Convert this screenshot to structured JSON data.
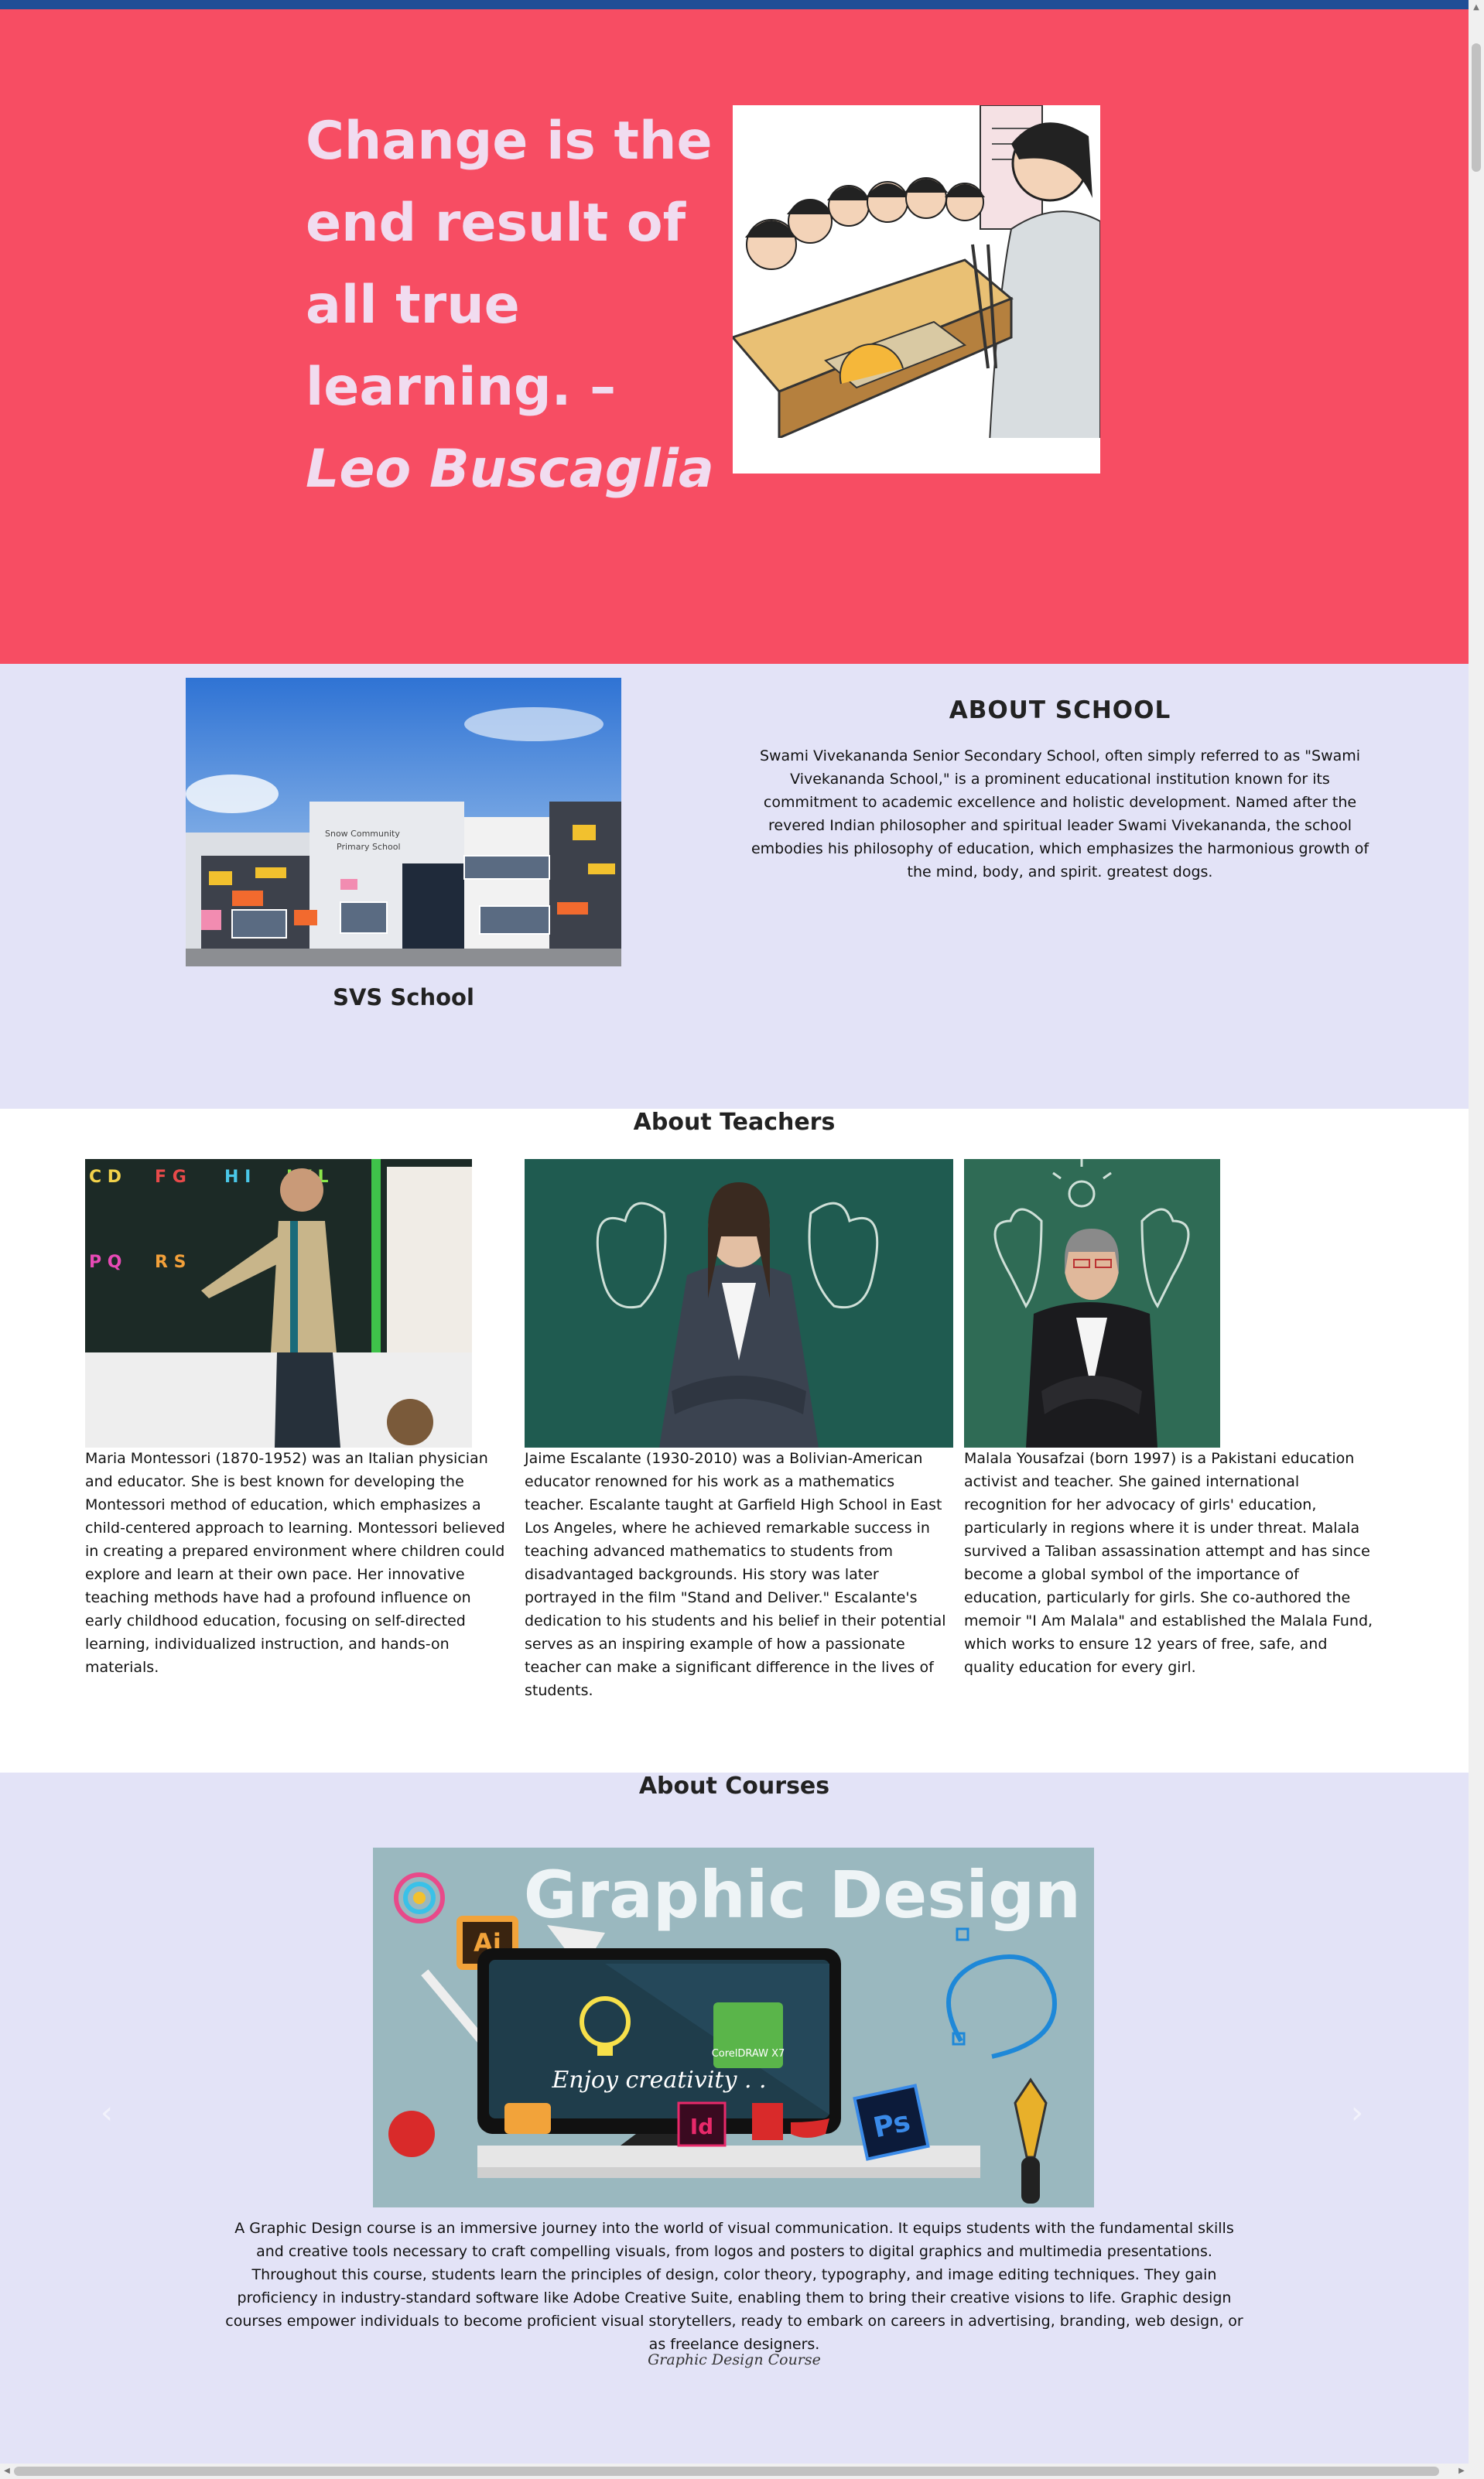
{
  "hero": {
    "quote": "Change is the end result of all true learning. –",
    "author": "Leo Buscaglia"
  },
  "about_school": {
    "photo_caption": "SVS School",
    "sign_text": "Snow Community Primary School",
    "title": "ABOUT SCHOOL",
    "text": "Swami Vivekananda Senior Secondary School, often simply referred to as \"Swami Vivekananda School,\" is a prominent educational institution known for its commitment to academic excellence and holistic development. Named after the revered Indian philosopher and spiritual leader Swami Vivekananda, the school embodies his philosophy of education, which emphasizes the harmonious growth of the mind, body, and spirit. greatest dogs."
  },
  "teachers": {
    "title": "About Teachers",
    "items": [
      {
        "text": "Maria Montessori (1870-1952) was an Italian physician and educator. She is best known for developing the Montessori method of education, which emphasizes a child-centered approach to learning. Montessori believed in creating a prepared environment where children could explore and learn at their own pace. Her innovative teaching methods have had a profound influence on early childhood education, focusing on self-directed learning, individualized instruction, and hands-on materials."
      },
      {
        "text": "Jaime Escalante (1930-2010) was a Bolivian-American educator renowned for his work as a mathematics teacher. Escalante taught at Garfield High School in East Los Angeles, where he achieved remarkable success in teaching advanced mathematics to students from disadvantaged backgrounds. His story was later portrayed in the film \"Stand and Deliver.\" Escalante's dedication to his students and his belief in their potential serves as an inspiring example of how a passionate teacher can make a significant difference in the lives of students."
      },
      {
        "text": "Malala Yousafzai (born 1997) is a Pakistani education activist and teacher. She gained international recognition for her advocacy of girls' education, particularly in regions where it is under threat. Malala survived a Taliban assassination attempt and has since become a global symbol of the importance of education, particularly for girls. She co-authored the memoir \"I Am Malala\" and established the Malala Fund, which works to ensure 12 years of free, safe, and quality education for every girl."
      }
    ]
  },
  "courses": {
    "title": "About Courses",
    "slide_heading": "Graphic Design",
    "slide_tagline": "Enjoy creativity . .",
    "slide_badges": [
      "Ai",
      "Id",
      "Ps",
      "CorelDRAW X7"
    ],
    "description": "A Graphic Design course is an immersive journey into the world of visual communication. It equips students with the fundamental skills and creative tools necessary to craft compelling visuals, from logos and posters to digital graphics and multimedia presentations. Throughout this course, students learn the principles of design, color theory, typography, and image editing techniques. They gain proficiency in industry-standard software like Adobe Creative Suite, enabling them to bring their creative visions to life. Graphic design courses empower individuals to become proficient visual storytellers, ready to embark on careers in advertising, branding, web design, or as freelance designers.",
    "caption": "Graphic Design Course",
    "prev_icon": "‹",
    "next_icon": "›"
  },
  "colors": {
    "hero_bg": "#f74d63",
    "hero_text": "#f1dcf0",
    "section_bg": "#e3e3f7",
    "topbar": "#1f4e96"
  }
}
